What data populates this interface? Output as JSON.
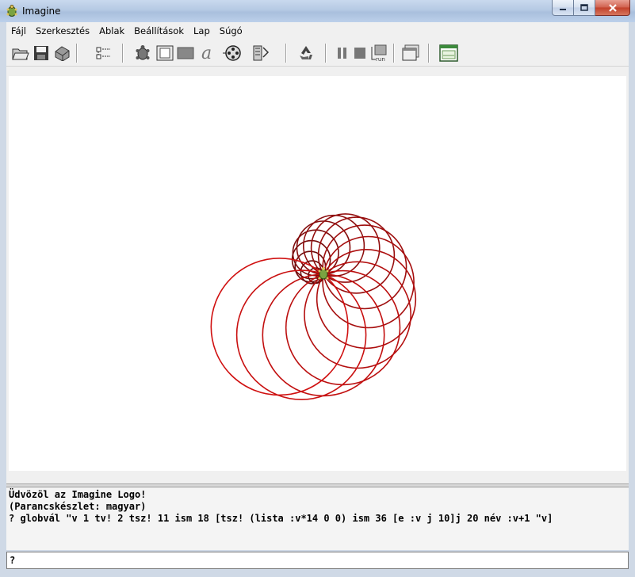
{
  "window": {
    "title": "Imagine"
  },
  "menu": [
    "Fájl",
    "Szerkesztés",
    "Ablak",
    "Beállítások",
    "Lap",
    "Súgó"
  ],
  "toolbar": {
    "icons": [
      "open-folder-icon",
      "save-disk-icon",
      "print-icon",
      "page-list-icon",
      "turtle-icon",
      "frame-icon",
      "filled-rect-icon",
      "text-a-icon",
      "film-reel-icon",
      "pen-icon",
      "recycle-icon",
      "pause-icon",
      "stop-icon",
      "run-icon",
      "window-icon",
      "panel-icon"
    ]
  },
  "console": {
    "lines": [
      "Üdvözöl az Imagine Logo!",
      "(Parancskészlet: magyar)",
      "? globvál \"v 1 tv! 2 tsz! 11 ism 18 [tsz! (lista :v*14 0 0) ism 36 [e :v j 10]j 20 név :v+1 \"v]"
    ]
  },
  "command_input": {
    "value": "?"
  },
  "drawing": {
    "circle_count": 18,
    "step": 14,
    "colors": [
      "#5a0a0a",
      "#d01010"
    ]
  }
}
